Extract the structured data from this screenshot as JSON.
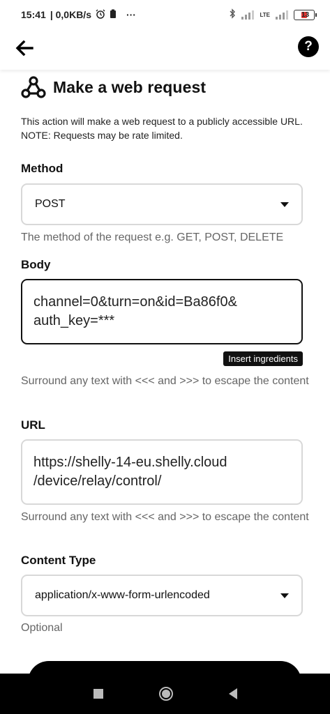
{
  "status_bar": {
    "time": "15:41",
    "net_speed": "| 0,0KB/s",
    "more": "···",
    "lte": "LTE",
    "battery": "13"
  },
  "app_bar": {
    "back_icon": "arrow-left-icon",
    "help_label": "?"
  },
  "header": {
    "icon": "webhooks-icon",
    "title": "Make a web request",
    "description": "This action will make a web request to a publicly accessible URL. NOTE: Requests may be rate limited."
  },
  "method": {
    "label": "Method",
    "value": "POST",
    "hint": "The method of the request e.g. GET, POST, DELETE"
  },
  "body": {
    "label": "Body",
    "value_line1": "channel=0&turn=on&id=Ba86f0&",
    "value_line2": "auth_key=***",
    "insert_label": "Insert ingredients",
    "hint": "Surround any text with <<< and >>> to escape the content"
  },
  "url": {
    "label": "URL",
    "value_line1": "https://shelly-14-eu.shelly.cloud",
    "value_line2": "/device/relay/control/",
    "hint": "Surround any text with <<< and >>> to escape the content"
  },
  "content_type": {
    "label": "Content Type",
    "value": "application/x-www-form-urlencoded",
    "hint": "Optional"
  },
  "colors": {
    "accent": "#111111",
    "hint": "#666666",
    "border": "#d8d8d8"
  }
}
